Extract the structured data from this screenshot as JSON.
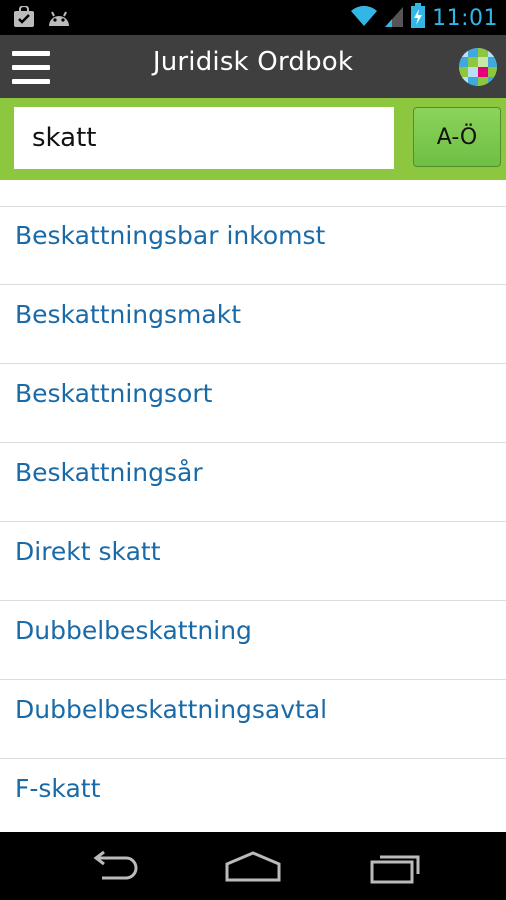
{
  "status_bar": {
    "time": "11:01",
    "left_icons": [
      "bag-check-icon",
      "android-icon"
    ],
    "right_icons": [
      "wifi-icon",
      "signal-icon",
      "battery-charging-icon"
    ]
  },
  "action_bar": {
    "title": "Juridisk Ordbok",
    "menu_icon": "hamburger-menu-icon",
    "logo_icon": "app-logo-icon"
  },
  "search": {
    "value": "skatt",
    "button_label": "A-Ö"
  },
  "results": [
    {
      "label": "Beskattningsbar inkomst"
    },
    {
      "label": "Beskattningsmakt"
    },
    {
      "label": "Beskattningsort"
    },
    {
      "label": "Beskattningsår"
    },
    {
      "label": "Direkt skatt"
    },
    {
      "label": "Dubbelbeskattning"
    },
    {
      "label": "Dubbelbeskattningsavtal"
    },
    {
      "label": "F-skatt"
    }
  ],
  "nav_bar": {
    "icons": [
      "back-icon",
      "home-icon",
      "recent-apps-icon"
    ]
  },
  "colors": {
    "accent_green": "#8dc63f",
    "link_blue": "#1a6aa8",
    "action_bar": "#3f3f3f",
    "time_blue": "#33b5e5"
  }
}
